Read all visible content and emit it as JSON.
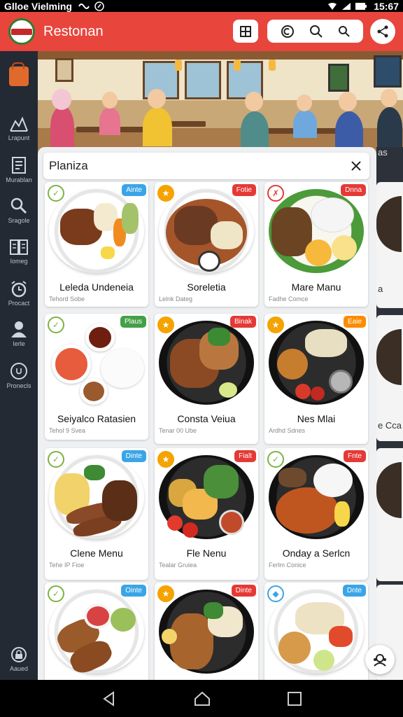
{
  "status_bar": {
    "carrier": "Glloe Vielming",
    "time": "15:67"
  },
  "app_bar": {
    "title": "Restonan"
  },
  "sidebar": {
    "items": [
      {
        "label": "Lrapunt",
        "icon": "chart-mountain-icon"
      },
      {
        "label": "Murablan",
        "icon": "document-icon"
      },
      {
        "label": "Sragole",
        "icon": "search-icon"
      },
      {
        "label": "Iomeg",
        "icon": "book-icon"
      },
      {
        "label": "Procact",
        "icon": "alarm-icon"
      },
      {
        "label": "Ierle",
        "icon": "person-icon"
      },
      {
        "label": "Pronecls",
        "icon": "clock-icon"
      },
      {
        "label": "Aaued",
        "icon": "lock-icon"
      }
    ]
  },
  "search": {
    "value": "Planiza"
  },
  "cards": [
    {
      "name": "Leleda Undeneia",
      "sub": "Tehord Sobe",
      "badge": "Ainte",
      "badge_color": "blue",
      "icon_color": "green"
    },
    {
      "name": "Soreletia",
      "sub": "Lelnk Dateg",
      "badge": "Fotie",
      "badge_color": "red",
      "icon_color": "orange"
    },
    {
      "name": "Mare Manu",
      "sub": "Fadhe Comce",
      "badge": "Dnna",
      "badge_color": "red",
      "icon_color": "red"
    },
    {
      "name": "Seiyalco Ratasien",
      "sub": "Tehol 9 Svea",
      "badge": "Plaus",
      "badge_color": "green",
      "icon_color": "green"
    },
    {
      "name": "Consta Veiua",
      "sub": "Tenar 00 Ube",
      "badge": "Binak",
      "badge_color": "red",
      "icon_color": "orange"
    },
    {
      "name": "Nes Mlai",
      "sub": "Ardhd Sdnes",
      "badge": "Eaie",
      "badge_color": "orange",
      "icon_color": "orange"
    },
    {
      "name": "Clene Menu",
      "sub": "Tehe IP Fioe",
      "badge": "Dinte",
      "badge_color": "blue",
      "icon_color": "green"
    },
    {
      "name": "Fle Nenu",
      "sub": "Tealar Gruiea",
      "badge": "Fialt",
      "badge_color": "red",
      "icon_color": "orange"
    },
    {
      "name": "Onday a Serlcn",
      "sub": "Ferlm Conice",
      "badge": "Fnte",
      "badge_color": "red",
      "icon_color": "green"
    },
    {
      "name": "",
      "sub": "",
      "badge": "Ointe",
      "badge_color": "blue",
      "icon_color": "green"
    },
    {
      "name": "",
      "sub": "",
      "badge": "Dinte",
      "badge_color": "red",
      "icon_color": "orange"
    },
    {
      "name": "",
      "sub": "",
      "badge": "Dnte",
      "badge_color": "blue",
      "icon_color": "blue"
    }
  ],
  "peek": {
    "top_label": "as",
    "mid_label": "a",
    "bottom_label": "e Cca"
  }
}
